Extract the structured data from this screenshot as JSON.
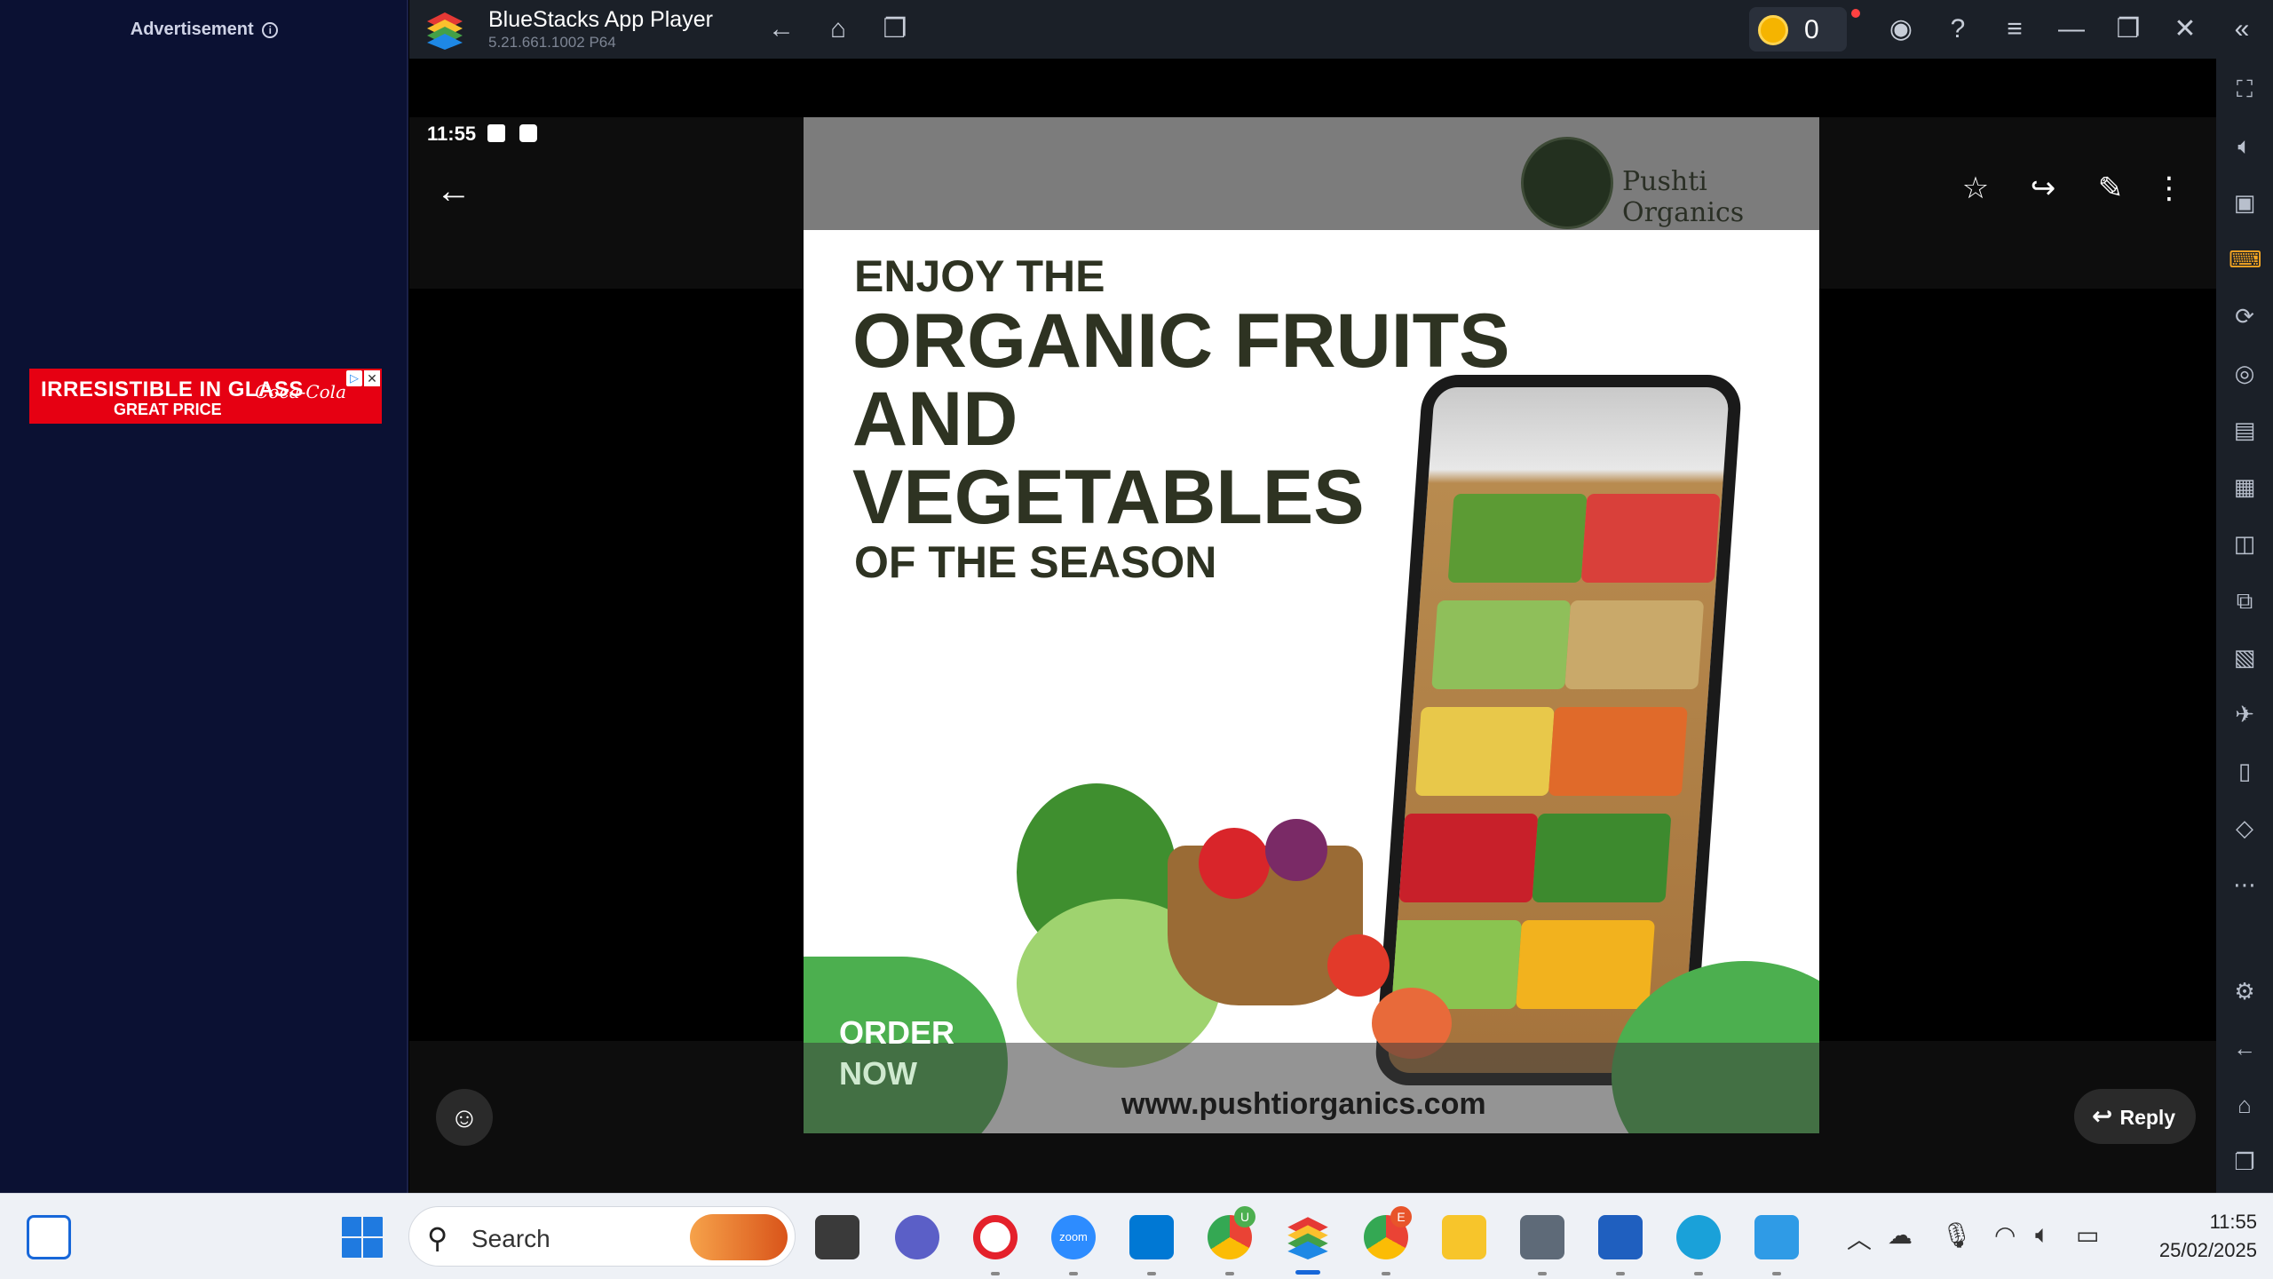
{
  "ad": {
    "label": "Advertisement",
    "info_glyph": "i",
    "banner_line1": "IRRESISTIBLE IN GLASS",
    "banner_line2": "GREAT PRICE",
    "brand": "Coca-Cola"
  },
  "titlebar": {
    "app_name": "BlueStacks App Player",
    "version": "5.21.661.1002  P64",
    "coins": "0"
  },
  "android": {
    "time": "11:55",
    "reply_label": "Reply"
  },
  "poster": {
    "brand": "Pushti Organics",
    "line1": "ENJOY THE",
    "line2": "ORGANIC FRUITS",
    "line3": "AND",
    "line4": "VEGETABLES",
    "line5": "OF THE SEASON",
    "cta_line1": "ORDER",
    "cta_line2": "NOW",
    "url": "www.pushtiorganics.com"
  },
  "taskbar": {
    "search_placeholder": "Search",
    "time": "11:55",
    "date": "25/02/2025",
    "badge_u": "U",
    "badge_e": "E",
    "zoom_label": "zoom"
  },
  "colors": {
    "accent_green": "#4caf4f",
    "ad_red": "#e60012",
    "bluestacks_bar": "#1b2028"
  }
}
